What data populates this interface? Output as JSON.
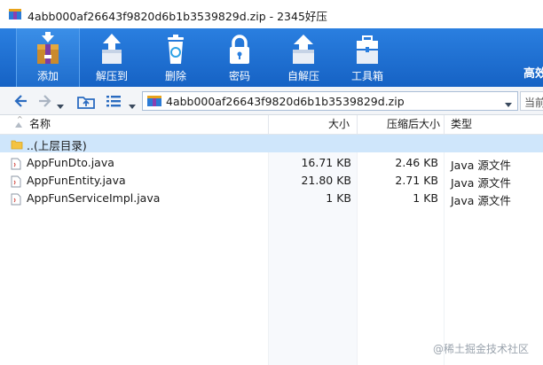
{
  "window": {
    "title": "4abb000af26643f9820d6b1b3539829d.zip - 2345好压"
  },
  "toolbar": {
    "buttons": [
      {
        "label": "添加",
        "icon": "add-archive-icon"
      },
      {
        "label": "解压到",
        "icon": "extract-to-icon"
      },
      {
        "label": "删除",
        "icon": "delete-trash-icon"
      },
      {
        "label": "密码",
        "icon": "lock-icon"
      },
      {
        "label": "自解压",
        "icon": "self-extract-icon"
      },
      {
        "label": "工具箱",
        "icon": "toolbox-icon"
      }
    ],
    "brand_partial": "高效"
  },
  "addressbar": {
    "path": "4abb000af26643f9820d6b1b3539829d.zip",
    "search_partial": "当前"
  },
  "list": {
    "columns": {
      "name": "名称",
      "size": "大小",
      "packed": "压缩后大小",
      "type": "类型"
    },
    "rows": [
      {
        "name": "..(上层目录)",
        "size": "",
        "packed": "",
        "type": "",
        "kind": "folder"
      },
      {
        "name": "AppFunDto.java",
        "size": "16.71 KB",
        "packed": "2.46 KB",
        "type": "Java 源文件",
        "kind": "file"
      },
      {
        "name": "AppFunEntity.java",
        "size": "21.80 KB",
        "packed": "2.71 KB",
        "type": "Java 源文件",
        "kind": "file"
      },
      {
        "name": "AppFunServiceImpl.java",
        "size": "1 KB",
        "packed": "1 KB",
        "type": "Java 源文件",
        "kind": "file"
      }
    ]
  },
  "watermark": "@稀土掘金技术社区",
  "colors": {
    "toolbar_blue": "#1f6fd1",
    "selected_row": "#cfe6fb"
  }
}
